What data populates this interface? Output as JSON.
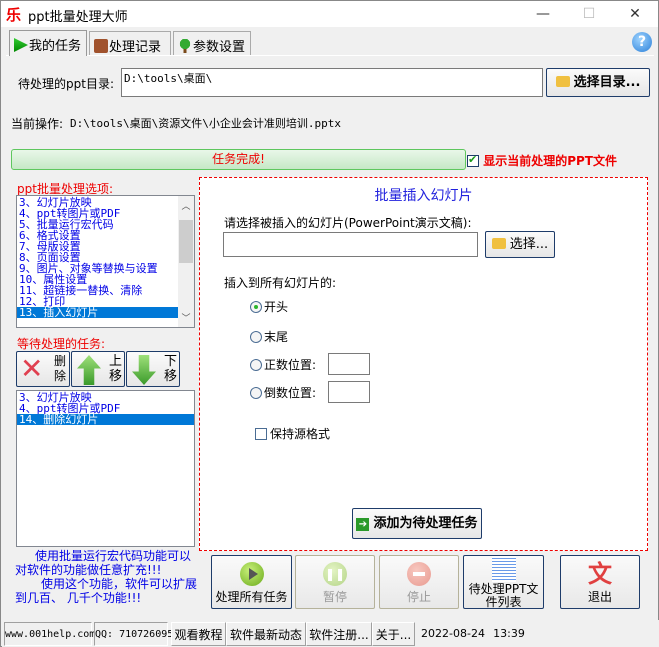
{
  "window": {
    "title": "ppt批量处理大师",
    "app_icon": "乐",
    "minimize": "—",
    "maximize": "☐",
    "close": "✕"
  },
  "tabs": [
    {
      "label": "我的任务",
      "icon": "play-icon",
      "active": true
    },
    {
      "label": "处理记录",
      "icon": "briefcase-icon",
      "active": false
    },
    {
      "label": "参数设置",
      "icon": "tree-icon",
      "active": false
    }
  ],
  "help_label": "?",
  "dir": {
    "label": "待处理的ppt目录:",
    "value": "D:\\tools\\桌面\\",
    "button": "选择目录..."
  },
  "current_op": {
    "label": "当前操作:",
    "value": "D:\\tools\\桌面\\资源文件\\小企业会计准则培训.pptx"
  },
  "progress": {
    "text": "任务完成!",
    "percent": 100
  },
  "show_current": {
    "label": "显示当前处理的PPT文件",
    "checked": true
  },
  "options": {
    "label": "ppt批量处理选项:",
    "items": [
      "3、幻灯片放映",
      "4、ppt转图片或PDF",
      "5、批量运行宏代码",
      "6、格式设置",
      "7、母版设置",
      "8、页面设置",
      "9、图片、对象等替换与设置",
      "10、属性设置",
      "11、超链接一替换、清除",
      "12、打印",
      "13、插入幻灯片"
    ],
    "selected_index": 10
  },
  "pending": {
    "label": "等待处理的任务:",
    "delete": "删除",
    "up": "上移",
    "down": "下移",
    "items": [
      "3、幻灯片放映",
      "4、ppt转图片或PDF",
      "14、删除幻灯片"
    ],
    "selected_index": 2
  },
  "info_text": {
    "line1": "使用批量运行宏代码功能可以对软件的功能做任意扩充!!!",
    "line2": "使用这个功能，软件可以扩展到几百、 几千个功能!!!"
  },
  "insert_panel": {
    "title": "批量插入幻灯片",
    "file_label": "请选择被插入的幻灯片(PowerPoint演示文稿):",
    "file_value": "",
    "choose_button": "选择...",
    "position_label": "插入到所有幻灯片的:",
    "radios": [
      {
        "label": "开头",
        "checked": true
      },
      {
        "label": "末尾",
        "checked": false
      },
      {
        "label": "正数位置:",
        "checked": false,
        "value": ""
      },
      {
        "label": "倒数位置:",
        "checked": false,
        "value": ""
      }
    ],
    "keep_format": {
      "label": "保持源格式",
      "checked": false
    },
    "add_button": "添加为待处理任务"
  },
  "actions": {
    "run_all": "处理所有任务",
    "pause": "暂停",
    "stop": "停止",
    "file_list": "待处理PPT文件列表",
    "exit": "退出"
  },
  "statusbar": {
    "site": "www.001help.com",
    "qq": "QQ: 710726095",
    "tutorial": "观看教程",
    "news": "软件最新动态",
    "register": "软件注册...",
    "about": "关于...",
    "date": "2022-08-24",
    "time": "13:39"
  },
  "colors": {
    "accent_red": "#ee0000",
    "list_blue": "#0000e6",
    "selection": "#0078d7"
  }
}
